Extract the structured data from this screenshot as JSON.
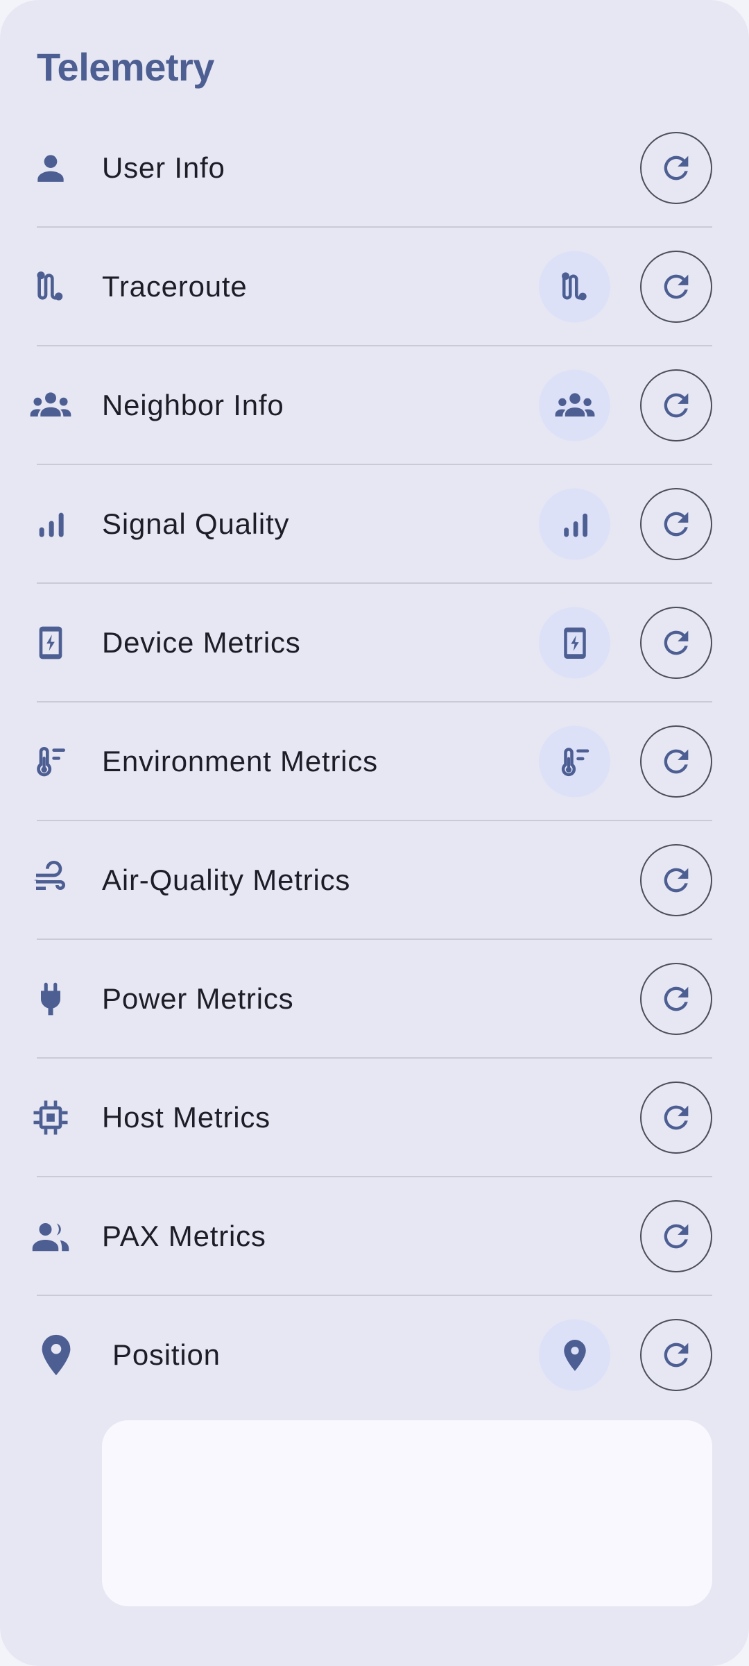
{
  "header": {
    "title": "Telemetry"
  },
  "items": [
    {
      "label": "User Info",
      "icon": "person-icon",
      "status_icon": null
    },
    {
      "label": "Traceroute",
      "icon": "route-icon",
      "status_icon": "route-icon"
    },
    {
      "label": "Neighbor Info",
      "icon": "groups-icon",
      "status_icon": "groups-icon"
    },
    {
      "label": "Signal Quality",
      "icon": "signal-bars-icon",
      "status_icon": "signal-bars-icon"
    },
    {
      "label": "Device Metrics",
      "icon": "battery-charging-phone-icon",
      "status_icon": "battery-charging-phone-icon"
    },
    {
      "label": "Environment Metrics",
      "icon": "thermometer-icon",
      "status_icon": "thermometer-icon"
    },
    {
      "label": "Air-Quality Metrics",
      "icon": "air-wind-icon",
      "status_icon": null
    },
    {
      "label": "Power Metrics",
      "icon": "power-plug-icon",
      "status_icon": null
    },
    {
      "label": "Host Metrics",
      "icon": "memory-chip-icon",
      "status_icon": null
    },
    {
      "label": "PAX Metrics",
      "icon": "people-icon",
      "status_icon": null
    },
    {
      "label": "Position",
      "icon": "location-pin-icon",
      "status_icon": "location-pin-icon"
    }
  ],
  "refresh_icon": "refresh-icon",
  "colors": {
    "accent": "#4c5e92",
    "surface": "#e7e7f3",
    "status_bg": "#dde1f7",
    "panel": "#f8f8fe"
  }
}
